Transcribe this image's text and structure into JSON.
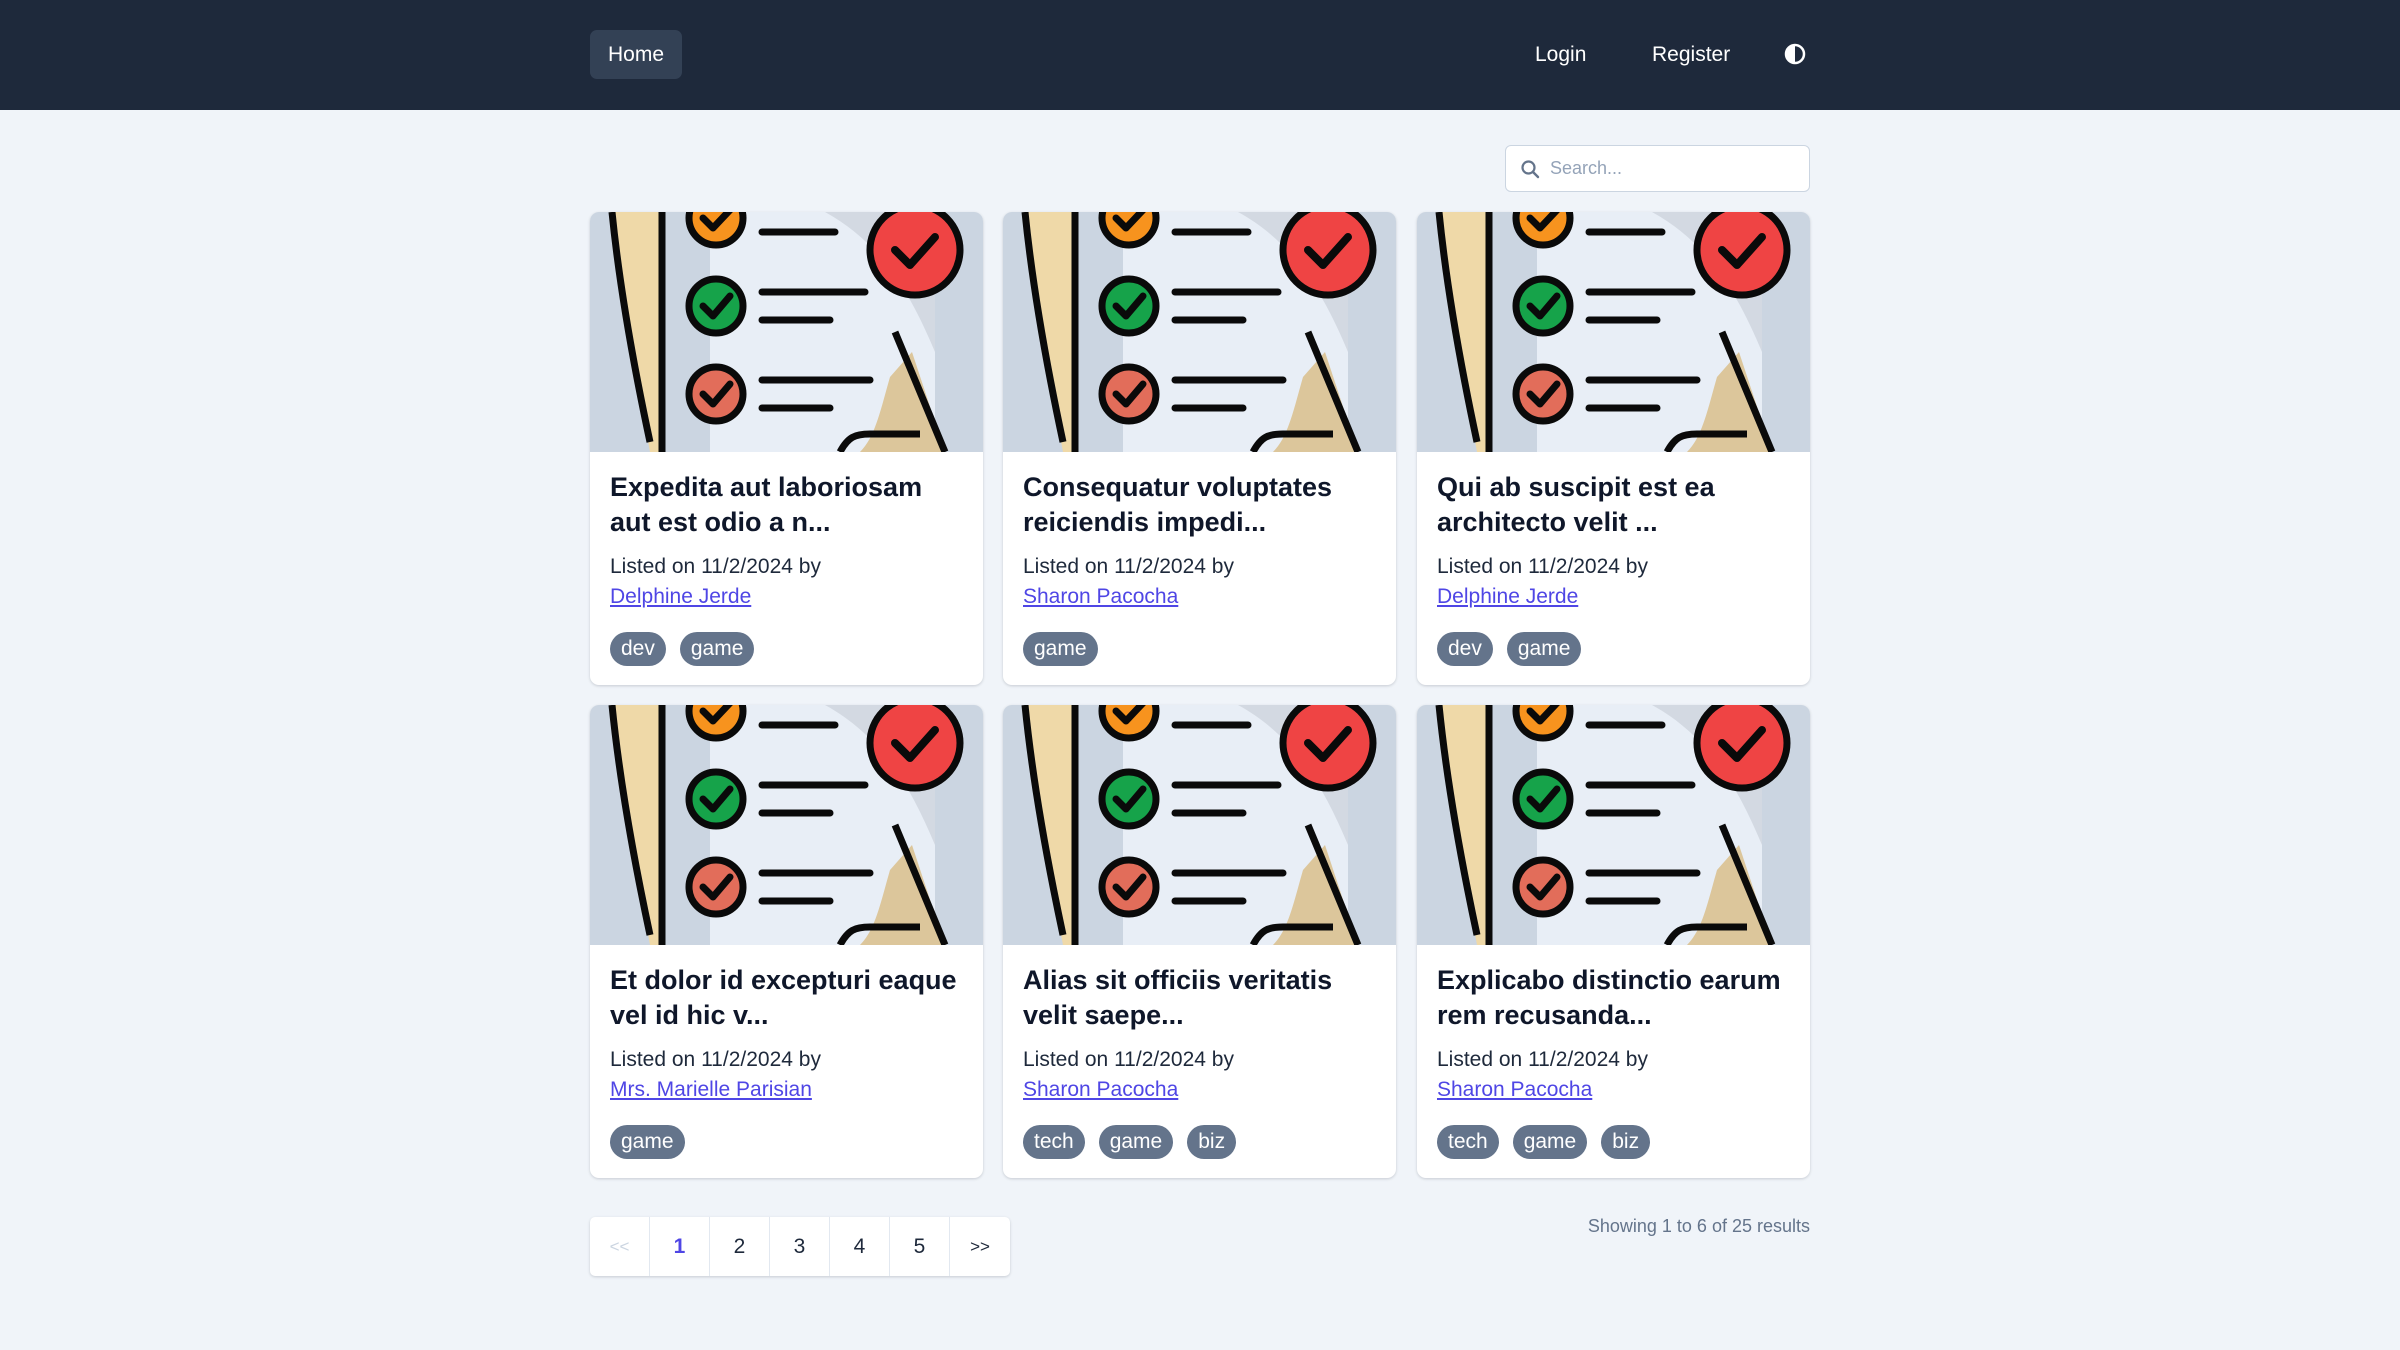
{
  "nav": {
    "home_label": "Home",
    "login_label": "Login",
    "register_label": "Register"
  },
  "search": {
    "placeholder": "Search...",
    "value": ""
  },
  "cards": [
    {
      "title": "Expedita aut laboriosam aut est odio a n...",
      "listed": "Listed on 11/2/2024 by",
      "author": "Delphine Jerde",
      "tags": [
        "dev",
        "game"
      ]
    },
    {
      "title": "Consequatur voluptates reiciendis impedi...",
      "listed": "Listed on 11/2/2024 by",
      "author": "Sharon Pacocha",
      "tags": [
        "game"
      ]
    },
    {
      "title": "Qui ab suscipit est ea architecto velit ...",
      "listed": "Listed on 11/2/2024 by",
      "author": "Delphine Jerde",
      "tags": [
        "dev",
        "game"
      ]
    },
    {
      "title": "Et dolor id excepturi eaque vel id hic v...",
      "listed": "Listed on 11/2/2024 by",
      "author": "Mrs. Marielle Parisian",
      "tags": [
        "game"
      ]
    },
    {
      "title": "Alias sit officiis veritatis velit saepe...",
      "listed": "Listed on 11/2/2024 by",
      "author": "Sharon Pacocha",
      "tags": [
        "tech",
        "game",
        "biz"
      ]
    },
    {
      "title": "Explicabo distinctio earum rem recusanda...",
      "listed": "Listed on 11/2/2024 by",
      "author": "Sharon Pacocha",
      "tags": [
        "tech",
        "game",
        "biz"
      ]
    }
  ],
  "pagination": {
    "prev_label": "<<",
    "next_label": ">>",
    "pages": [
      "1",
      "2",
      "3",
      "4",
      "5"
    ],
    "current": "1"
  },
  "results_text": "Showing 1 to 6 of 25 results",
  "icons": {
    "theme_toggle": "half-circle-contrast-icon",
    "search": "magnifier-icon",
    "card_image": "checklist-illustration"
  },
  "colors": {
    "topbar": "#1e293b",
    "home_button": "#334155",
    "page_background": "#f0f4f9",
    "link": "#4f46e5",
    "tag": "#64748b"
  }
}
